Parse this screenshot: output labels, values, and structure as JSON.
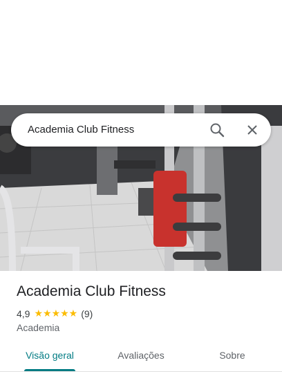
{
  "search": {
    "query": "Academia Club Fitness",
    "search_icon": "search-icon",
    "close_icon": "close-icon"
  },
  "place": {
    "name": "Academia Club Fitness",
    "rating": "4,9",
    "stars": "★★★★★",
    "star_count": 5,
    "reviews": "(9)",
    "category": "Academia"
  },
  "tabs": [
    {
      "label": "Visão geral",
      "active": true
    },
    {
      "label": "Avaliações",
      "active": false
    },
    {
      "label": "Sobre",
      "active": false
    }
  ],
  "colors": {
    "accent": "#007b83",
    "star": "#fbbc04",
    "text": "#202124"
  }
}
